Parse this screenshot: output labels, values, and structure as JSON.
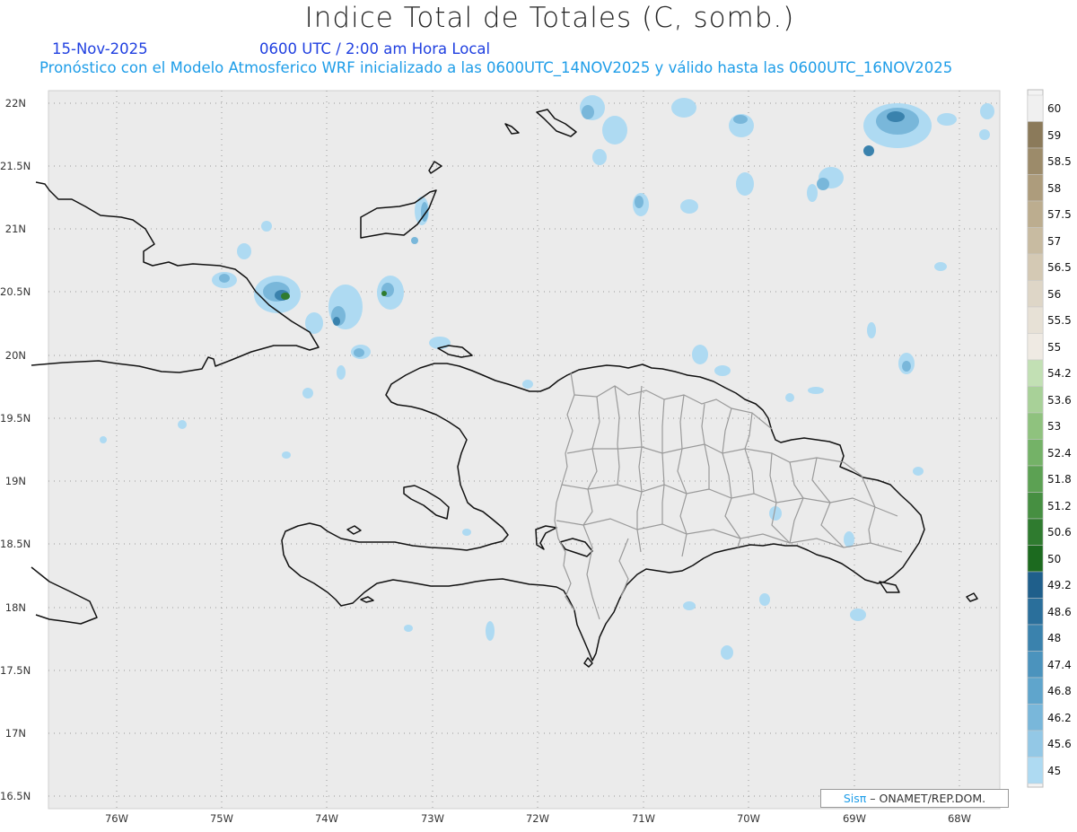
{
  "header": {
    "title": "Indice Total de Totales (C, somb.)",
    "date": "15-Nov-2025",
    "time": "0600 UTC / 2:00 am Hora Local",
    "forecast": "Pronóstico con el Modelo Atmosferico WRF inicializado a las 0600UTC_14NOV2025 y válido hasta las  0600UTC_16NOV2025"
  },
  "axes": {
    "lat_labels": [
      "22N",
      "21.5N",
      "21N",
      "20.5N",
      "20N",
      "19.5N",
      "19N",
      "18.5N",
      "18N",
      "17.5N",
      "17N",
      "16.5N"
    ],
    "lon_labels": [
      "76W",
      "75W",
      "74W",
      "73W",
      "72W",
      "71W",
      "70W",
      "69W",
      "68W"
    ]
  },
  "colorbar": {
    "labels": [
      "60",
      "59",
      "58.5",
      "58",
      "57.5",
      "57",
      "56.5",
      "56",
      "55.5",
      "55",
      "54.2",
      "53.6",
      "53",
      "52.4",
      "51.8",
      "51.2",
      "50.6",
      "50",
      "49.2",
      "48.6",
      "48",
      "47.4",
      "46.8",
      "46.2",
      "45.6",
      "45"
    ],
    "colors": [
      "#f0f0f0",
      "#8b7a5a",
      "#9c8b6a",
      "#ad9c7c",
      "#bcad8f",
      "#c8bba1",
      "#d4c9b4",
      "#ded6c7",
      "#e7e1d6",
      "#efeae3",
      "#c2e0b4",
      "#a8d198",
      "#8fc27e",
      "#74b267",
      "#5ca153",
      "#468f41",
      "#2f7b2f",
      "#1c6a1f",
      "#1f5f8b",
      "#2a6f9b",
      "#3a82ad",
      "#4b93bd",
      "#5fa5cc",
      "#79b7da",
      "#93c8e6",
      "#aedaf2"
    ]
  },
  "credit": {
    "brand": "Sisπ",
    "text": "– ONAMET/REP.DOM."
  }
}
